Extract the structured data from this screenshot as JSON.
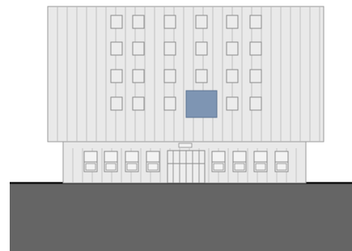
{
  "colors": {
    "background": "#ffffff",
    "facade_fill": "#e9e9e9",
    "facade_stroke": "#9a9a9a",
    "panel_line": "#b7b7b7",
    "window_stroke": "#8c8c8c",
    "window_fill": "#ececec",
    "highlight_window": "#7e95b3",
    "highlight_window_stroke": "#5f7593",
    "ground_line": "#111111",
    "ground_fill": "#656565"
  },
  "icons": {
    "building": "building-elevation-icon",
    "entrance": "entrance-doors-icon"
  }
}
